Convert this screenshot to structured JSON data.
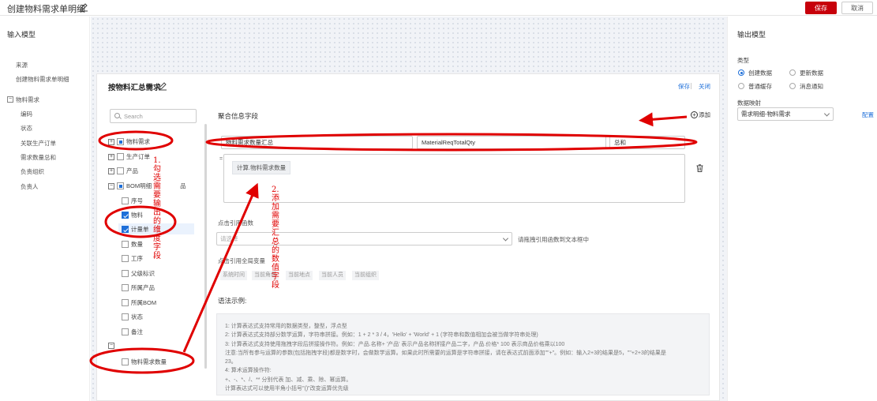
{
  "header": {
    "title": "创建物料需求单明细",
    "save_label": "保存",
    "cancel_label": "取消"
  },
  "left_panel": {
    "title": "输入模型",
    "source_label": "来源",
    "source_value": "创建物料需求单明细",
    "tree_root": "物料需求",
    "fields": [
      "编码",
      "状态",
      "关联生产订单",
      "需求数量总和",
      "负责组织",
      "负责人"
    ]
  },
  "right_panel": {
    "title": "输出模型",
    "type_label": "类型",
    "types": [
      "创建数据",
      "更新数据",
      "普通缓存",
      "消息通知"
    ],
    "selected_type": "创建数据",
    "mapping_label": "数据映射",
    "mapping_value": "需求明细-物料需求",
    "config_link": "配置"
  },
  "card": {
    "title": "按物料汇总需求",
    "save_link": "保存",
    "close_link": "关闭",
    "search_placeholder": "Search",
    "tree": {
      "material_demand": "物料需求",
      "production_order": "生产订单",
      "product": "产品",
      "bom_detail": "BOM明细",
      "bom_product_suffix": "品",
      "bom_children": [
        "序号",
        "物料",
        "计量单位",
        "数量",
        "工序",
        "父级标识",
        "所属产品",
        "所属BOM",
        "状态",
        "备注"
      ],
      "measure_unit_partial": "计量单",
      "calc_item": "物料需求数量"
    },
    "aggregate": {
      "title": "聚合信息字段",
      "add_label": "添加",
      "field_name": "物料需求数量汇总",
      "field_code": "MaterialReqTotalQty",
      "field_func": "总和",
      "formula_tag": "计算.物料需求数量"
    },
    "func_ref_label": "点击引用函数",
    "func_select_placeholder": "请选择",
    "func_hint": "请拖拽引用函数到文本框中",
    "global_var_label": "点击引用全局变量",
    "global_vars": [
      "系统时间",
      "当前角色",
      "当前地点",
      "当前人员",
      "当前组织"
    ],
    "syntax_title": "语法示例:",
    "syntax_lines": [
      "1: 计算表达式支持常用的数据类型，整型，浮点型",
      "2: 计算表达式支持部分数学运算，字符串拼接。例如：1 + 2 * 3 / 4，'Hello' + 'World' + 1 (字符串和数值相加会被当做字符串处理)",
      "3: 计算表达式支持使用拖拽字段后拼接操作符。例如：产品.名称+ '产品' 表示产品名称拼接产品二字，产品.价格* 100 表示商品价格乘以100",
      "注意:当所有参与运算的参数(包括拖拽字段)都是数字时，会做数学运算。如果此时所需要的运算是字符串拼接，请在表达式前面添加\"\"+\"。例如：输入2+3的结果是5，\"\"+2+3的结果是",
      "23。",
      "4: 算术运算操作符:",
      "+、-、*、/、** 分别代表 加、减、乘、除、幂运算。",
      "计算表达式可以使用半角小括号\"()\"改变运算优先级"
    ]
  },
  "annotations": {
    "note1": "1.勾选需要输出的维度字段",
    "note2": "2.添加需要汇总的数值字段",
    "color": "#e00000"
  }
}
